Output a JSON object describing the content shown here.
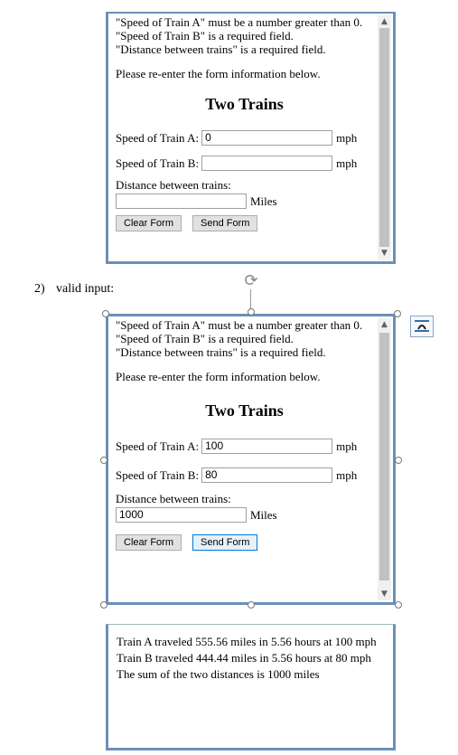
{
  "frame1": {
    "errors": [
      "\"Speed of Train A\" must be a number greater than 0.",
      "\"Speed of Train B\" is a required field.",
      "\"Distance between trains\" is a required field."
    ],
    "prompt": "Please re-enter the form information below.",
    "title": "Two Trains",
    "speed_a_label": "Speed of Train A:",
    "speed_a_value": "0",
    "speed_b_label": "Speed of Train B:",
    "speed_b_value": "",
    "unit_mph": "mph",
    "distance_label": "Distance between trains:",
    "distance_value": "",
    "unit_miles": "Miles",
    "clear_label": "Clear Form",
    "send_label": "Send Form"
  },
  "section_label": {
    "number": "2)",
    "text": "valid input:"
  },
  "frame2": {
    "errors": [
      "\"Speed of Train A\" must be a number greater than 0.",
      "\"Speed of Train B\" is a required field.",
      "\"Distance between trains\" is a required field."
    ],
    "prompt": "Please re-enter the form information below.",
    "title": "Two Trains",
    "speed_a_label": "Speed of Train A:",
    "speed_a_value": "100",
    "speed_b_label": "Speed of Train B:",
    "speed_b_value": "80",
    "unit_mph": "mph",
    "distance_label": "Distance between trains:",
    "distance_value": "1000",
    "unit_miles": "Miles",
    "clear_label": "Clear Form",
    "send_label": "Send Form"
  },
  "result": {
    "lines": [
      "Train A traveled 555.56 miles in 5.56 hours at 100 mph",
      "Train B traveled 444.44 miles in 5.56 hours at 80 mph",
      "The sum of the two distances is 1000 miles"
    ]
  },
  "icons": {
    "rotate": "rotate-handle-icon",
    "layout": "layout-options-icon",
    "scroll_up": "chevron-up-icon",
    "scroll_down": "chevron-down-icon"
  },
  "colors": {
    "frame_border": "#6b8fb8",
    "scroll_thumb": "#c1c1c1",
    "focus_border": "#0078d7"
  }
}
